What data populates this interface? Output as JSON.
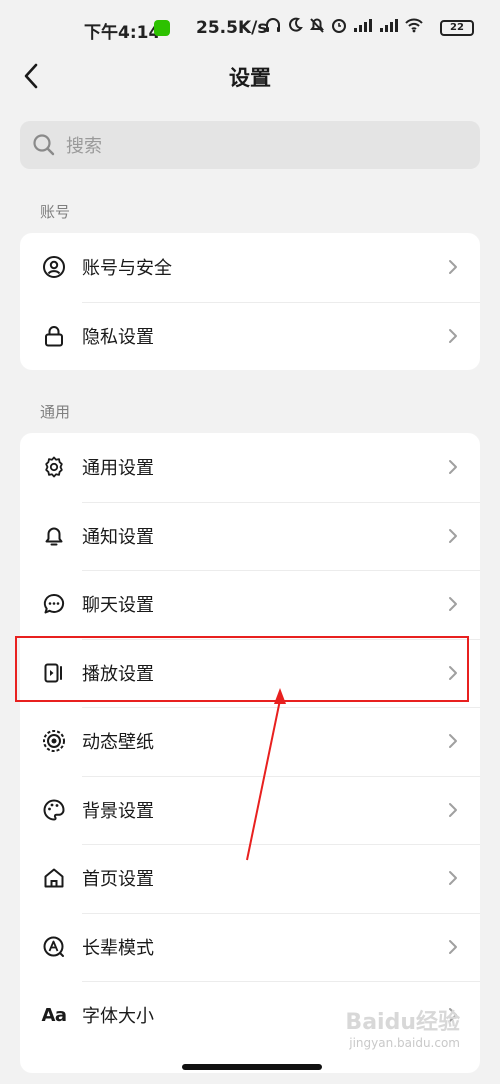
{
  "status_bar": {
    "time": "下午4:14",
    "net_speed": "25.5K/s",
    "battery": "22"
  },
  "header": {
    "title": "设置"
  },
  "search": {
    "placeholder": "搜索"
  },
  "sections": [
    {
      "label": "账号",
      "items": [
        {
          "label": "账号与安全",
          "icon": "user-circle-icon"
        },
        {
          "label": "隐私设置",
          "icon": "lock-icon"
        }
      ]
    },
    {
      "label": "通用",
      "items": [
        {
          "label": "通用设置",
          "icon": "gear-icon"
        },
        {
          "label": "通知设置",
          "icon": "bell-icon"
        },
        {
          "label": "聊天设置",
          "icon": "chat-bubble-icon"
        },
        {
          "label": "播放设置",
          "icon": "play-device-icon"
        },
        {
          "label": "动态壁纸",
          "icon": "live-wallpaper-icon"
        },
        {
          "label": "背景设置",
          "icon": "palette-icon"
        },
        {
          "label": "首页设置",
          "icon": "home-icon"
        },
        {
          "label": "长辈模式",
          "icon": "elder-mode-icon"
        },
        {
          "label": "字体大小",
          "icon": "font-size-icon",
          "glyph": "Aa"
        }
      ]
    }
  ],
  "annotation": {
    "highlight_color": "#e8201f"
  },
  "watermark": {
    "brand": "Baidu经验",
    "url": "jingyan.baidu.com"
  }
}
